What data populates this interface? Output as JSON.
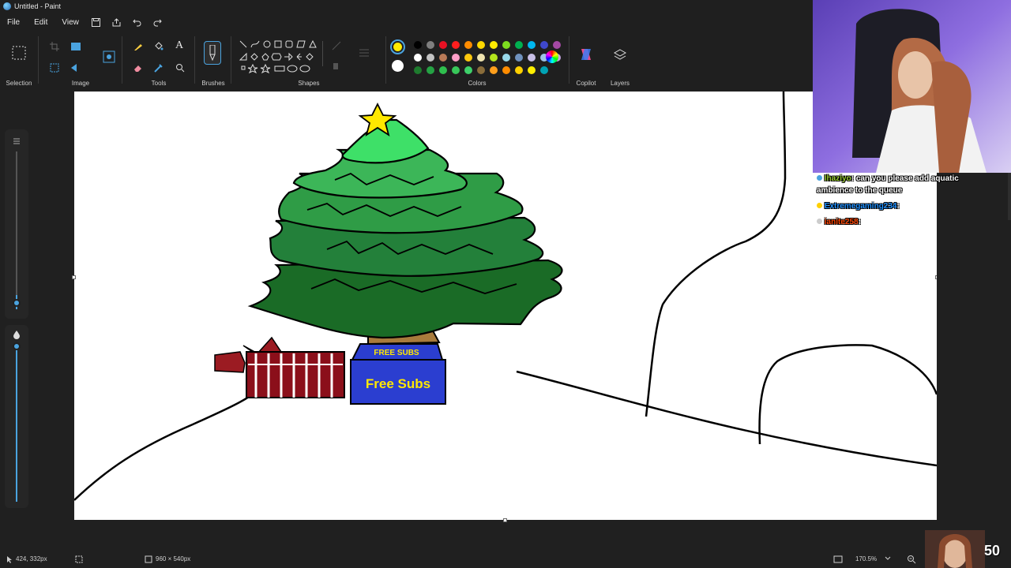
{
  "window": {
    "title": "Untitled - Paint"
  },
  "menu": {
    "file": "File",
    "edit": "Edit",
    "view": "View"
  },
  "ribbon": {
    "groups": {
      "selection": "Selection",
      "image": "Image",
      "tools": "Tools",
      "brushes": "Brushes",
      "shapes": "Shapes",
      "colors": "Colors",
      "copilot": "Copilot",
      "layers": "Layers"
    },
    "primary_color": "#ffeb00",
    "secondary_color": "#ffffff",
    "palette_row1": [
      "#000000",
      "#7f7f7f",
      "#e81123",
      "#ff1e1e",
      "#ff8c00",
      "#ffd800",
      "#ffea00",
      "#7ddc1f",
      "#00b050",
      "#00b7ef",
      "#3f48cc",
      "#a349a4"
    ],
    "palette_row2": [
      "#ffffff",
      "#c3c3c3",
      "#b97a57",
      "#ff9ec7",
      "#ffc90e",
      "#efe4b0",
      "#b5e61d",
      "#99d9ea",
      "#7092be",
      "#c8bfe7",
      "#9dc3e6",
      "#c5a5e0"
    ],
    "palette_row3": [
      "#1e7b2e",
      "#25a244",
      "#2fbf4e",
      "#38c75a",
      "#3ed16a",
      "#8a6d3b",
      "#ff9f1c",
      "#ff8c00",
      "#ffd000",
      "#ffee00",
      "#00a3b5"
    ]
  },
  "drawing": {
    "gift_label_small": "FREE SUBS",
    "gift_label_large": "Free Subs"
  },
  "status": {
    "cursor_position": "424, 332px",
    "canvas_size": "960 × 540px",
    "zoom": "170.5%"
  },
  "stream": {
    "chat": [
      {
        "user": "Ihaziyo",
        "sep": ":",
        "message": "can you please add aquatic ambience to the queue",
        "color": "#9acd32"
      },
      {
        "user": "Extremegaming234",
        "sep": ":",
        "message": "",
        "color": "#1e90ff"
      },
      {
        "user": "ianite258",
        "sep": ":",
        "message": "",
        "color": "#ff4500"
      }
    ],
    "sub_count": "50"
  }
}
